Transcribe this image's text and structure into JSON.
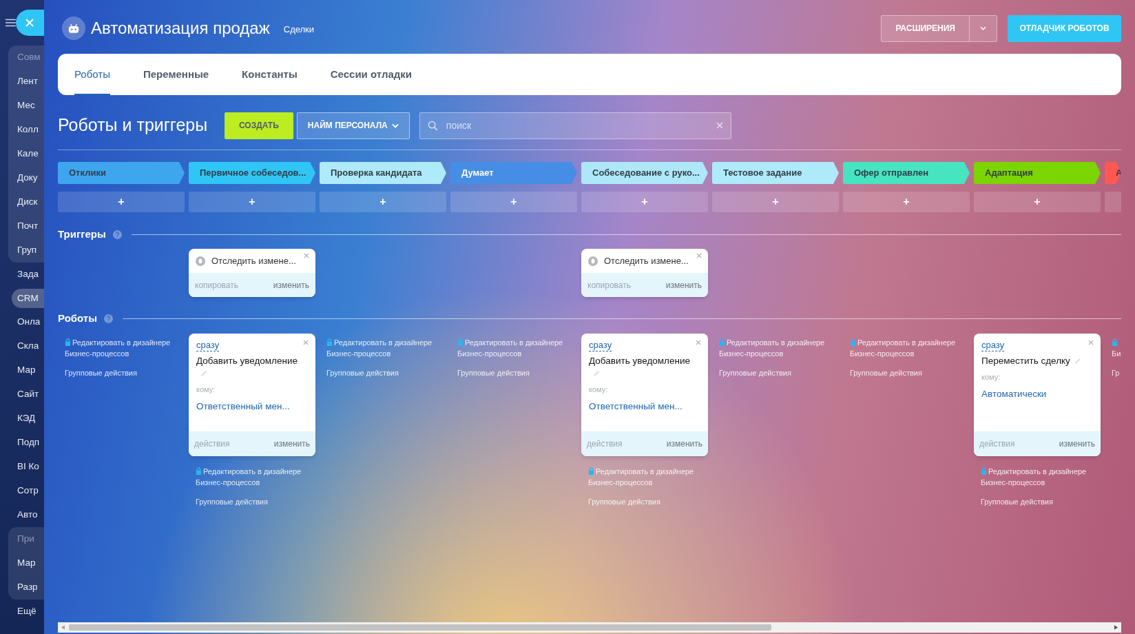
{
  "sidebar": {
    "sections": [
      {
        "kind": "group",
        "items": [
          {
            "label": "Совм",
            "kind": "header",
            "selected": false
          },
          {
            "label": "Лент",
            "kind": "link",
            "selected": false
          },
          {
            "label": "Мес",
            "kind": "link",
            "selected": false
          },
          {
            "label": "Колл",
            "kind": "link",
            "selected": false
          },
          {
            "label": "Кале",
            "kind": "link",
            "selected": false
          },
          {
            "label": "Доку",
            "kind": "link",
            "selected": false
          },
          {
            "label": "Диск",
            "kind": "link",
            "selected": false
          },
          {
            "label": "Почт",
            "kind": "link",
            "selected": false
          },
          {
            "label": "Груп",
            "kind": "link",
            "selected": false
          }
        ]
      },
      {
        "kind": "plain",
        "items": [
          {
            "label": "Зада",
            "kind": "link",
            "selected": false
          },
          {
            "label": "CRM",
            "kind": "link",
            "selected": true
          },
          {
            "label": "Онла",
            "kind": "link",
            "selected": false
          },
          {
            "label": "Скла",
            "kind": "link",
            "selected": false
          },
          {
            "label": "Мар",
            "kind": "link",
            "selected": false
          },
          {
            "label": "Сайт",
            "kind": "link",
            "selected": false
          },
          {
            "label": "КЭД",
            "kind": "link",
            "selected": false
          },
          {
            "label": "Подп",
            "kind": "link",
            "selected": false
          },
          {
            "label": "BI Ко",
            "kind": "link",
            "selected": false
          },
          {
            "label": "Сотр",
            "kind": "link",
            "selected": false
          },
          {
            "label": "Авто",
            "kind": "link",
            "selected": false
          }
        ]
      },
      {
        "kind": "group",
        "items": [
          {
            "label": "При",
            "kind": "header",
            "selected": false
          },
          {
            "label": "Мар",
            "kind": "link",
            "selected": false
          },
          {
            "label": "Разр",
            "kind": "link",
            "selected": false
          }
        ]
      },
      {
        "kind": "plain",
        "items": [
          {
            "label": "Ещё",
            "kind": "link",
            "selected": false
          }
        ]
      }
    ]
  },
  "header": {
    "title": "Автоматизация продаж",
    "subtitle": "Сделки",
    "extensions_button": "РАСШИРЕНИЯ",
    "debugger_button": "ОТЛАДЧИК РОБОТОВ"
  },
  "tabs": [
    {
      "label": "Роботы",
      "selected": true
    },
    {
      "label": "Переменные",
      "selected": false
    },
    {
      "label": "Константы",
      "selected": false
    },
    {
      "label": "Сессии отладки",
      "selected": false
    }
  ],
  "toolbar": {
    "title": "Роботы и триггеры",
    "create_button": "СОЗДАТЬ",
    "pipeline_button": "НАЙМ ПЕРСОНАЛА",
    "search": {
      "placeholder": "поиск"
    }
  },
  "sections": {
    "triggers": "Триггеры",
    "robots": "Роботы"
  },
  "columns": [
    {
      "stage": {
        "label": "Отклики",
        "color": "#3ea6ef"
      },
      "add": "+",
      "designer_link": "Редактировать в дизайнере Бизнес-процессов",
      "group_actions": "Групповые действия"
    },
    {
      "stage": {
        "label": "Первичное собеседов...",
        "color": "#2fc6f6"
      },
      "add": "+",
      "trigger": {
        "title": "Отследить измене...",
        "copy": "копировать",
        "edit": "изменить"
      },
      "robot": {
        "delay": "сразу",
        "title": "Добавить уведомление",
        "to_label": "кому:",
        "to_value": "Ответственный мен...",
        "actions": "действия",
        "edit": "изменить"
      },
      "designer_link": "Редактировать в дизайнере Бизнес-процессов",
      "group_actions": "Групповые действия"
    },
    {
      "stage": {
        "label": "Проверка кандидата",
        "color": "#aeeaf9"
      },
      "add": "+",
      "designer_link": "Редактировать в дизайнере Бизнес-процессов",
      "group_actions": "Групповые действия"
    },
    {
      "stage": {
        "label": "Думает",
        "color": "#468ee5"
      },
      "add": "+",
      "designer_link": "Редактировать в дизайнере Бизнес-процессов",
      "group_actions": "Групповые действия"
    },
    {
      "stage": {
        "label": "Собеседование с руко...",
        "color": "#aee8f8"
      },
      "add": "+",
      "trigger": {
        "title": "Отследить измене...",
        "copy": "копировать",
        "edit": "изменить"
      },
      "robot": {
        "delay": "сразу",
        "title": "Добавить уведомление",
        "to_label": "кому:",
        "to_value": "Ответственный мен...",
        "actions": "действия",
        "edit": "изменить"
      },
      "designer_link": "Редактировать в дизайнере Бизнес-процессов",
      "group_actions": "Групповые действия"
    },
    {
      "stage": {
        "label": "Тестовое задание",
        "color": "#aeeaf9"
      },
      "add": "+",
      "designer_link": "Редактировать в дизайнере Бизнес-процессов",
      "group_actions": "Групповые действия"
    },
    {
      "stage": {
        "label": "Офер отправлен",
        "color": "#47e4c2"
      },
      "add": "+",
      "designer_link": "Редактировать в дизайнере Бизнес-процессов",
      "group_actions": "Групповые действия"
    },
    {
      "stage": {
        "label": "Адаптация",
        "color": "#7bd500"
      },
      "add": "+",
      "robot": {
        "delay": "сразу",
        "title": "Переместить сделку",
        "to_label": "кому:",
        "to_value": "Автоматически",
        "actions": "действия",
        "edit": "изменить"
      },
      "designer_link": "Редактировать в дизайнере Бизнес-процессов",
      "group_actions": "Групповые действия"
    },
    {
      "stage": {
        "label": "А",
        "color": "#ff5752"
      },
      "designer_link": "Би",
      "group_actions": "Гр"
    }
  ]
}
